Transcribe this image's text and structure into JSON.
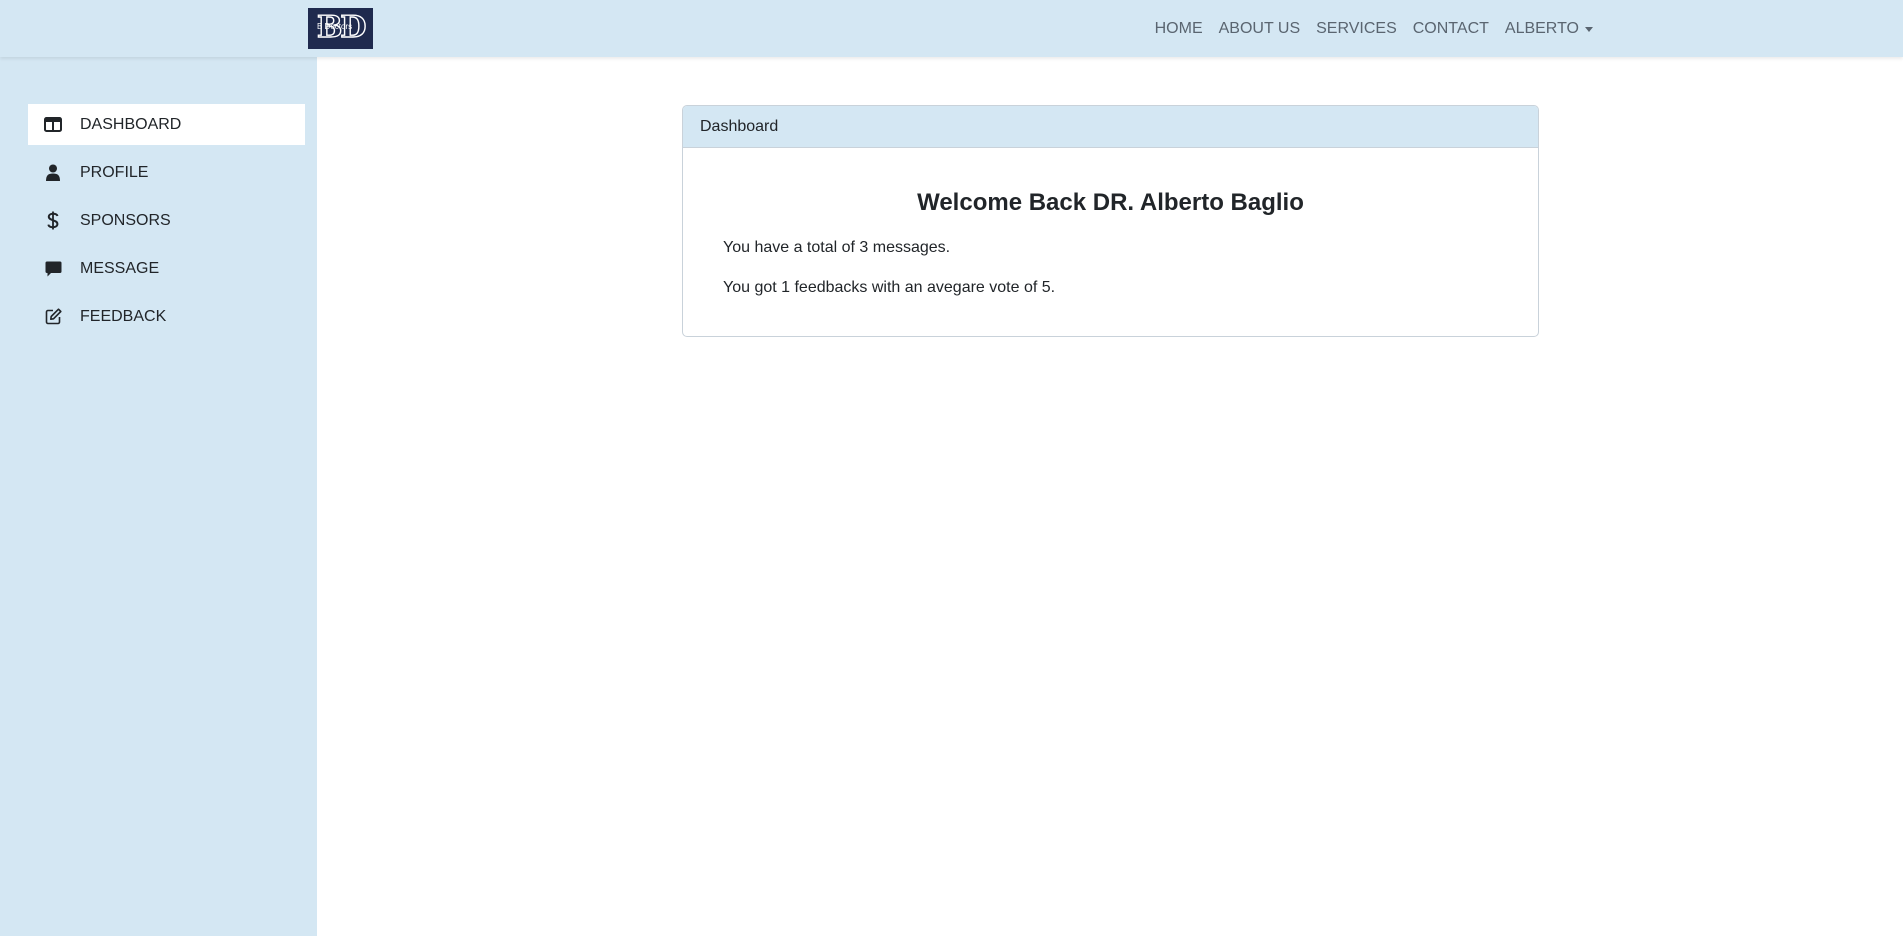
{
  "brand": {
    "logo_monogram": "BD",
    "logo_subtext": "B Doctors",
    "logo_bg": "#1f2a4e"
  },
  "nav": {
    "links": [
      "HOME",
      "ABOUT US",
      "SERVICES",
      "CONTACT"
    ],
    "user_label": "ALBERTO"
  },
  "sidebar": {
    "items": [
      {
        "label": "DASHBOARD",
        "icon": "dashboard-icon",
        "active": true
      },
      {
        "label": "PROFILE",
        "icon": "user-icon",
        "active": false
      },
      {
        "label": "SPONSORS",
        "icon": "dollar-icon",
        "active": false
      },
      {
        "label": "MESSAGE",
        "icon": "message-icon",
        "active": false
      },
      {
        "label": "FEEDBACK",
        "icon": "edit-icon",
        "active": false
      }
    ]
  },
  "card": {
    "header": "Dashboard",
    "title": "Welcome Back DR. Alberto Baglio",
    "messages_line": "You have a total of 3 messages.",
    "feedback_line": "You got 1 feedbacks with an avegare vote of 5."
  },
  "colors": {
    "panel_bg": "#d4e7f3",
    "text": "#212529",
    "nav_text": "#5a6570"
  }
}
